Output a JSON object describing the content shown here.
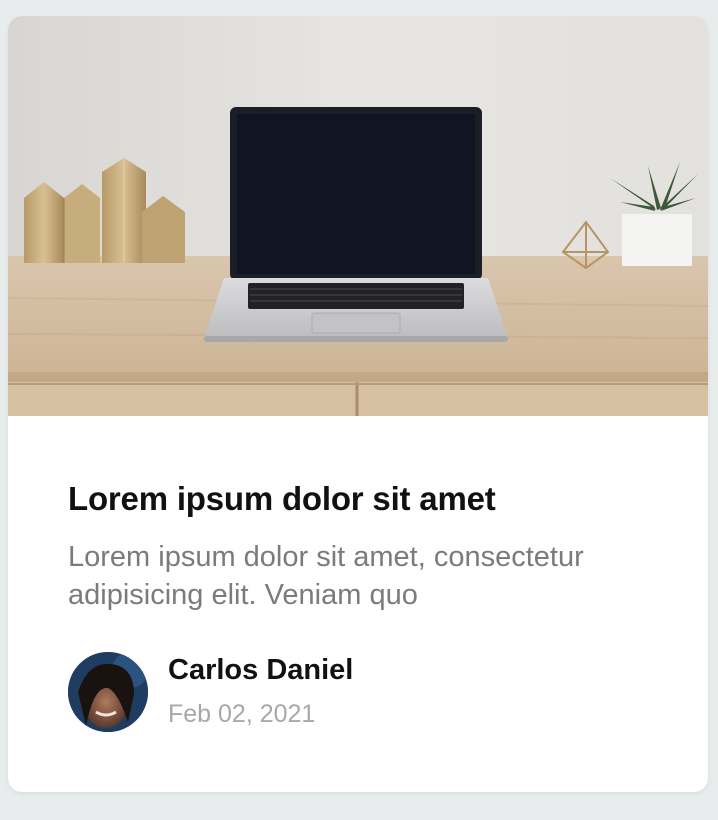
{
  "card": {
    "title": "Lorem ipsum dolor sit amet",
    "description": "Lorem ipsum dolor sit amet, consectetur adipisicing elit. Veniam quo",
    "author": {
      "name": "Carlos Daniel",
      "date": "Feb 02, 2021"
    }
  },
  "colors": {
    "background": "#e8eced",
    "card": "#ffffff",
    "title": "#111111",
    "description": "#7b7b7b",
    "date": "#a8a8a8"
  }
}
